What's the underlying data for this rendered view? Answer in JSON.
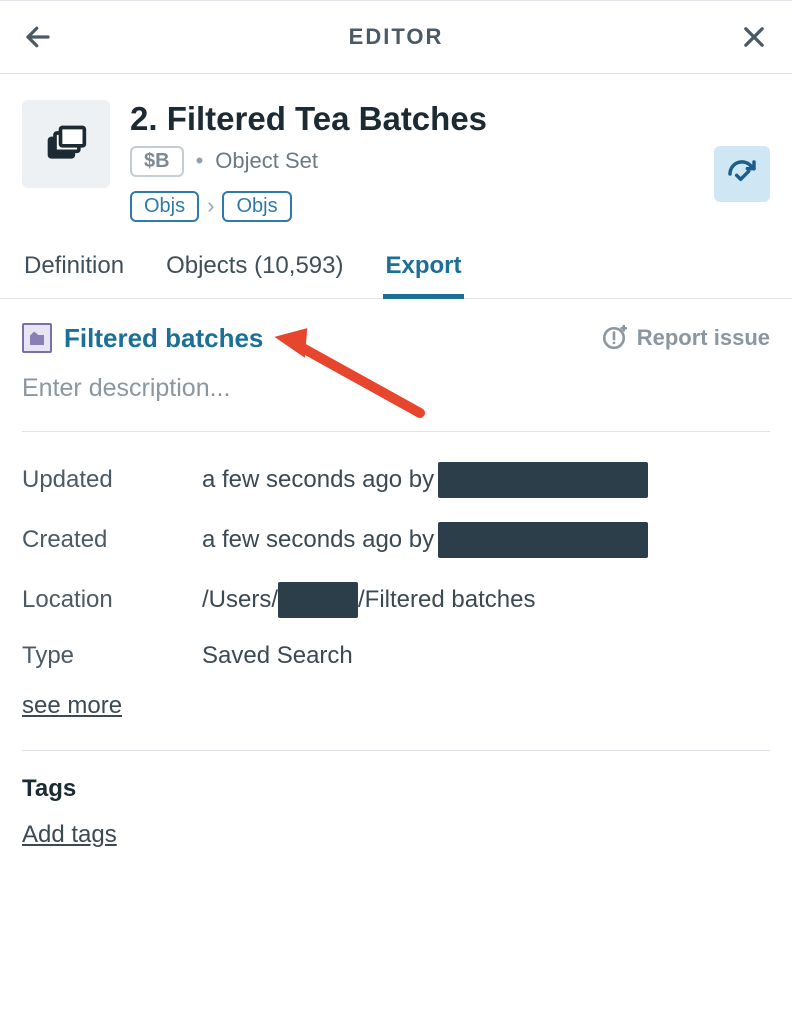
{
  "header": {
    "title": "EDITOR"
  },
  "title": {
    "text": "2. Filtered Tea Batches",
    "chip": "$B",
    "kind": "Object Set"
  },
  "crumbs": {
    "a": "Objs",
    "b": "Objs"
  },
  "tabs": {
    "definition": "Definition",
    "objects": "Objects (10,593)",
    "export": "Export"
  },
  "export": {
    "name": "Filtered batches",
    "report_issue": "Report issue",
    "description_placeholder": "Enter description...",
    "description_value": ""
  },
  "meta": {
    "updated_label": "Updated",
    "updated_text": "a few seconds ago by",
    "created_label": "Created",
    "created_text": "a few seconds ago by",
    "location_label": "Location",
    "location_prefix": "/Users/",
    "location_suffix": "/Filtered batches",
    "type_label": "Type",
    "type_value": "Saved Search",
    "see_more": "see more"
  },
  "tags": {
    "title": "Tags",
    "add": "Add tags"
  }
}
